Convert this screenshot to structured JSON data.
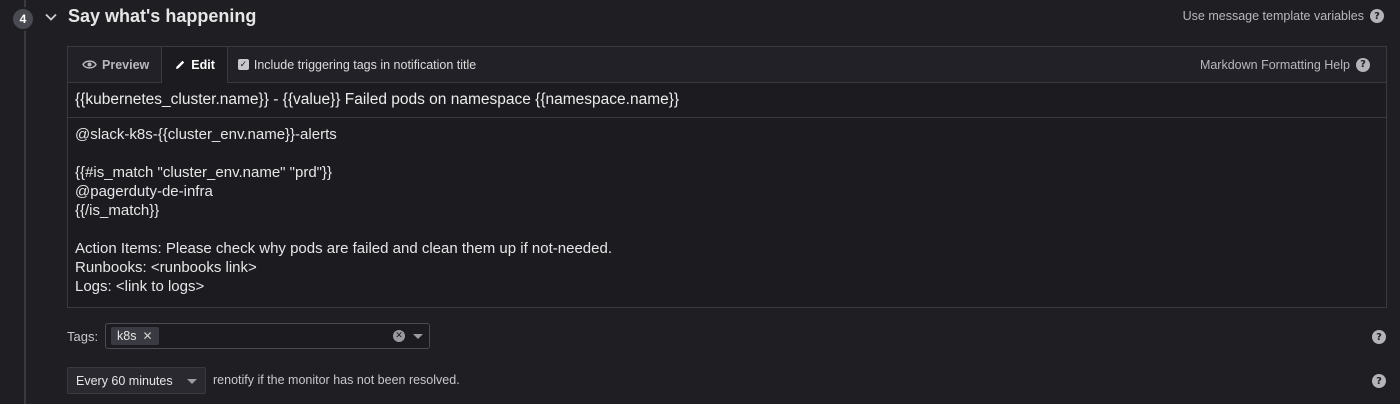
{
  "step": {
    "number": "4",
    "title": "Say what's happening"
  },
  "header_link": {
    "label": "Use message template variables",
    "icon": "help-icon"
  },
  "editor": {
    "tabs": [
      {
        "label": "Preview",
        "icon": "eye-icon"
      },
      {
        "label": "Edit",
        "icon": "pencil-icon",
        "active": true
      }
    ],
    "include_tags": {
      "label": "Include triggering tags in notification title",
      "checked": true
    },
    "markdown_help": "Markdown Formatting Help",
    "title_value": "{{kubernetes_cluster.name}} - {{value}} Failed pods on namespace {{namespace.name}}",
    "body_value": "@slack-k8s-{{cluster_env.name}}-alerts\n\n{{#is_match \"cluster_env.name\" \"prd\"}}\n@pagerduty-de-infra\n{{/is_match}}\n\nAction Items: Please check why pods are failed and clean them up if not-needed.\nRunbooks: <runbooks link>\nLogs: <link to logs>"
  },
  "tags": {
    "label": "Tags:",
    "chips": [
      "k8s"
    ]
  },
  "renotify": {
    "selected": "Every 60 minutes",
    "suffix": "renotify if the monitor has not been resolved."
  },
  "colors": {
    "background": "#1f1e23",
    "border": "#3a3a40",
    "text": "#dcdcdc"
  }
}
